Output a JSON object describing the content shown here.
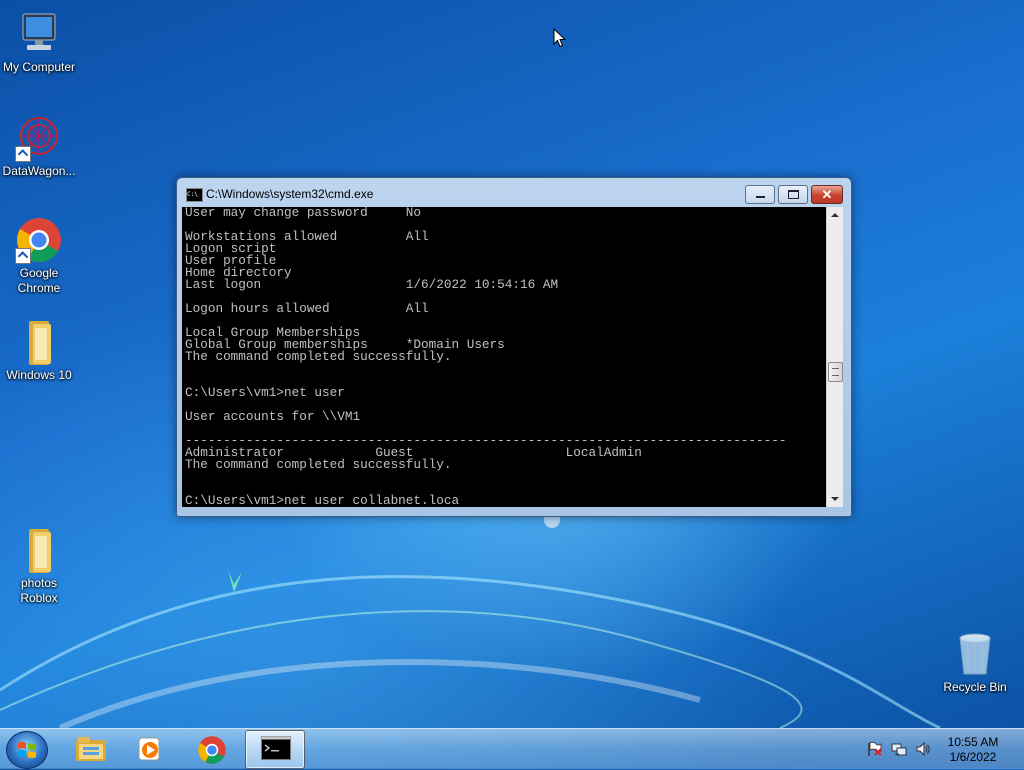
{
  "desktop": {
    "icons": [
      {
        "label": "My Computer"
      },
      {
        "label": "DataWagon..."
      },
      {
        "label": "Google Chrome"
      },
      {
        "label": "Windows 10"
      },
      {
        "label": "photos Roblox"
      },
      {
        "label": "Recycle Bin"
      }
    ]
  },
  "window": {
    "title": "C:\\Windows\\system32\\cmd.exe",
    "icon_text": "C:\\",
    "close_glyph": "✕",
    "console_lines": [
      "User may change password     No",
      "",
      "Workstations allowed         All",
      "Logon script",
      "User profile",
      "Home directory",
      "Last logon                   1/6/2022 10:54:16 AM",
      "",
      "Logon hours allowed          All",
      "",
      "Local Group Memberships",
      "Global Group memberships     *Domain Users",
      "The command completed successfully.",
      "",
      "",
      "C:\\Users\\vm1>net user",
      "",
      "User accounts for \\\\VM1",
      "",
      "-------------------------------------------------------------------------------",
      "Administrator            Guest                    LocalAdmin",
      "The command completed successfully.",
      "",
      "",
      "C:\\Users\\vm1>net user collabnet.loca"
    ]
  },
  "taskbar": {
    "items": [
      "start-button",
      "windows-explorer",
      "media-player",
      "google-chrome",
      "command-prompt"
    ],
    "clock": {
      "time": "10:55 AM",
      "date": "1/6/2022"
    }
  },
  "colors": {
    "console_bg": "#000000",
    "console_fg": "#c0c0c0",
    "desktop_blue": "#1a6fcf"
  }
}
